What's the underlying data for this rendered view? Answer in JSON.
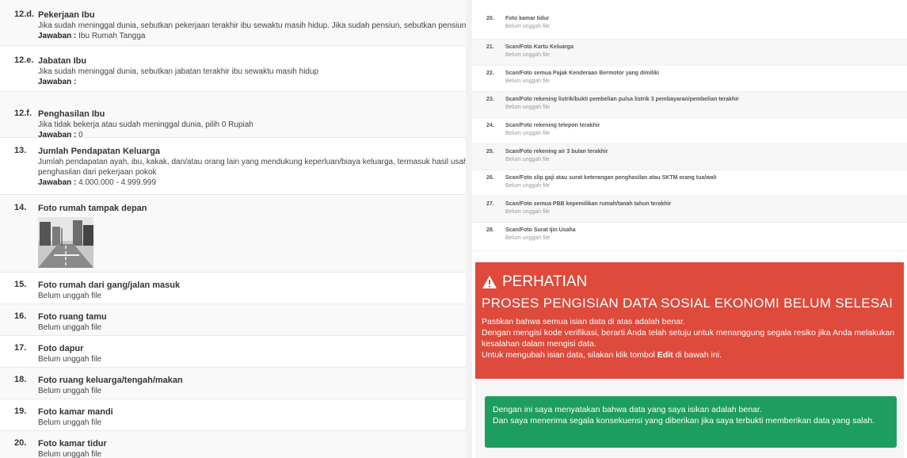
{
  "left": {
    "items": [
      {
        "num": "12.d.",
        "title": "Pekerjaan Ibu",
        "desc": "Jika sudah meninggal dunia, sebutkan pekerjaan terakhir ibu sewaktu masih hidup. Jika sudah pensiun, sebutkan pensiunan apa",
        "answer_label": "Jawaban :",
        "answer_value": "Ibu Rumah Tangga"
      },
      {
        "num": "12.e.",
        "title": "Jabatan Ibu",
        "desc": "Jika sudah meninggal dunia, sebutkan jabatan terakhir ibu sewaktu masih hidup",
        "answer_label": "Jawaban :",
        "answer_value": ""
      },
      {
        "num": "12.f.",
        "title": "Penghasilan Ibu",
        "desc": "Jika tidak bekerja atau sudah meninggal dunia, pilih 0 Rupiah",
        "answer_label": "Jawaban :",
        "answer_value": "0"
      },
      {
        "num": "13.",
        "title": "Jumlah Pendapatan Keluarga",
        "desc": "Jumlah pendapatan ayah, ibu, kakak, dan/atau orang lain yang mendukung keperluan/biaya keluarga, termasuk hasil usaha samping",
        "desc2": "penghasilan dari pekerjaan pokok",
        "answer_label": "Jawaban :",
        "answer_value": "4.000.000 - 4.999.999"
      },
      {
        "num": "14.",
        "title": "Foto rumah tampak depan"
      },
      {
        "num": "15.",
        "title": "Foto rumah dari gang/jalan masuk",
        "status": "Belum unggah file"
      },
      {
        "num": "16.",
        "title": "Foto ruang tamu",
        "status": "Belum unggah file"
      },
      {
        "num": "17.",
        "title": "Foto dapur",
        "status": "Belum unggah file"
      },
      {
        "num": "18.",
        "title": "Foto ruang keluarga/tengah/makan",
        "status": "Belum unggah file"
      },
      {
        "num": "19.",
        "title": "Foto kamar mandi",
        "status": "Belum unggah file"
      },
      {
        "num": "20.",
        "title": "Foto kamar tidur",
        "status": "Belum unggah file"
      }
    ]
  },
  "right": {
    "items": [
      {
        "num": "20.",
        "title": "Foto kamar tidur",
        "status": "Belum unggah file"
      },
      {
        "num": "21.",
        "title": "Scan/Foto Kartu Keluarga",
        "status": "Belum unggah file"
      },
      {
        "num": "22.",
        "title": "Scan/Foto semua Pajak Kenderaan Bermotor yang dimiliki",
        "status": "Belum unggah file"
      },
      {
        "num": "23.",
        "title": "Scan/Foto rekening listrik/bukti pembelian pulsa listrik 3 pembayaran/pembelian terakhir",
        "status": "Belum unggah file"
      },
      {
        "num": "24.",
        "title": "Scan/Foto rekening telepon terakhir",
        "status": "Belum unggah file"
      },
      {
        "num": "25.",
        "title": "Scan/Foto rekening air 3 bulan terakhir",
        "status": "Belum unggah file"
      },
      {
        "num": "26.",
        "title": "Scan/Foto slip gaji atau surat keterangan penghasilan atau SKTM orang tua/wali",
        "status": "Belum unggah file"
      },
      {
        "num": "27.",
        "title": "Scan/Foto semua PBB kepemilikan rumah/tanah tahun terakhir",
        "status": "Belum unggah file"
      },
      {
        "num": "28.",
        "title": "Scan/Foto Surat Ijin Usaha",
        "status": "Belum unggah file"
      }
    ],
    "alert": {
      "color": "#de4a3b",
      "icon": "warning-triangle-icon",
      "heading": "PERHATIAN",
      "subheading": "PROSES PENGISIAN DATA SOSIAL EKONOMI BELUM SELESAI",
      "line1": "Pastikan bahwa semua isian data di atas adalah benar.",
      "line2": "Dengan mengisi kode verifikasi, berarti Anda telah setuju untuk menanggung segala resiko jika Anda melakukan kesalahan dalam mengisi data.",
      "line3_pre": "Untuk mengubah isian data, silakan klik tombol ",
      "line3_bold": "Edit",
      "line3_post": " di bawah ini."
    },
    "confirm": {
      "color": "#1e9e5e",
      "line1": "Dengan ini saya menyatakan bahwa data yang saya isikan adalah benar.",
      "line2": "Dan saya menerima segala konsekuensi yang diberikan jika saya terbukti memberikan data yang salah."
    }
  }
}
